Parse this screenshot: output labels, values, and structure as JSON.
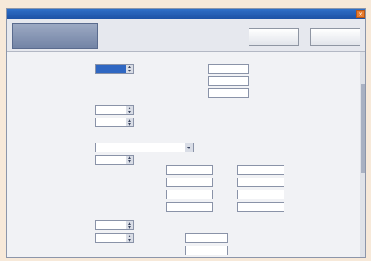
{
  "window": {
    "title": ""
  },
  "toolbar": {
    "tab_line1": "",
    "tab_line2": "",
    "save_label": "",
    "cancel_label": ""
  },
  "form": {
    "row1": {
      "label": "",
      "value": "",
      "mid_label": ""
    },
    "fields": [
      {
        "label": "",
        "value": "",
        "unit": ""
      },
      {
        "label": "",
        "value": "",
        "unit": ""
      },
      {
        "label": "",
        "value": "",
        "unit": ""
      }
    ],
    "spins": [
      {
        "label": "",
        "value": ""
      },
      {
        "label": "",
        "value": ""
      }
    ],
    "faint_label": "",
    "measurement": {
      "label": "",
      "value": ""
    },
    "tolerance": {
      "label": "",
      "value": "",
      "header_left": "",
      "header_right": "",
      "rows": [
        {
          "name": "",
          "left": "",
          "right": ""
        },
        {
          "name": "",
          "left": "",
          "right": ""
        },
        {
          "name": "",
          "left": "",
          "right": ""
        },
        {
          "name": "",
          "left": "",
          "right": ""
        }
      ]
    },
    "resolution": {
      "label": "",
      "value": "",
      "unit": ""
    },
    "calculation": {
      "label": "",
      "value": "",
      "coefficients": [
        {
          "label": "",
          "value": ""
        },
        {
          "label": "",
          "value": ""
        }
      ]
    }
  }
}
